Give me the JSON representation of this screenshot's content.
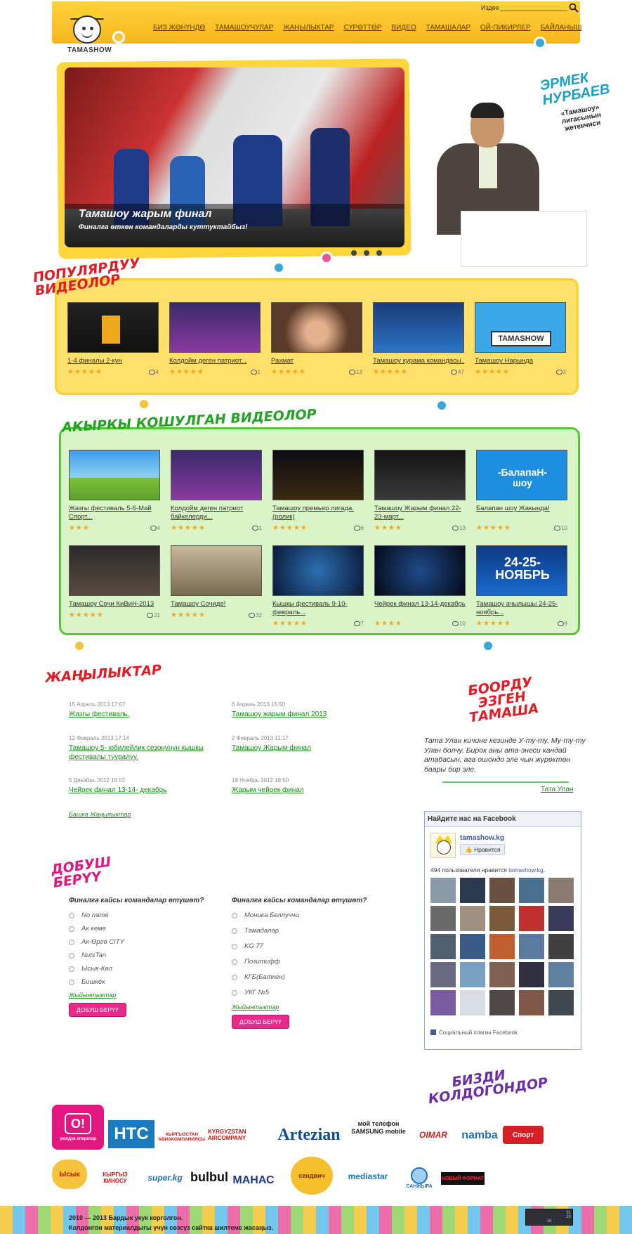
{
  "header": {
    "logo_text": "TAMASHOW",
    "search_label": "Издөө",
    "search_value": "",
    "nav": [
      "БИЗ ЖӨНҮНДӨ",
      "ТАМАШОУЧУЛАР",
      "ЖАҢЫЛЫКТАР",
      "СҮРӨТТӨР",
      "ВИДЕО",
      "ТАМАШАЛАР",
      "ОЙ-ПИКИРЛЕР",
      "БАЙЛАНЫШ"
    ]
  },
  "hero": {
    "title": "Тамашоу жарым финал",
    "subtitle": "Финалга өткөн командаларды куттуктайбыз!",
    "slides": 3,
    "host_name": "ЭРМЕК НУРБАЕВ",
    "host_role": "«Тамашоу» лигасынын жетекчиси"
  },
  "popular": {
    "title": "ПОПУЛЯРДУУ ВИДЕОЛОР",
    "videos": [
      {
        "title": "1-4 финалы 2-кун",
        "stars": "★★★★★",
        "comments": "4"
      },
      {
        "title": "Колдойм деген патриот...",
        "stars": "★★★★★",
        "comments": "1"
      },
      {
        "title": "Рахмат",
        "stars": "★★★★★",
        "comments": "13"
      },
      {
        "title": "Тамашоу курама командасы...",
        "stars": "★★★★★",
        "comments": "47"
      },
      {
        "title": "Тамашоу Нарында",
        "stars": "★★★★★",
        "comments": "3"
      }
    ]
  },
  "latest": {
    "title": "АКЫРКЫ КОШУЛГАН ВИДЕОЛОР",
    "videos": [
      {
        "title": "Жазгы фестиваль 5-6-Май Спорт...",
        "stars": "★★★",
        "comments": "4"
      },
      {
        "title": "Колдойм деген патриот байкелерди...",
        "stars": "★★★★★",
        "comments": "1"
      },
      {
        "title": "Тамашоу премьер лигада. (ролик)",
        "stars": "★★★★★",
        "comments": "6"
      },
      {
        "title": "Тамашоу Жарым финал 22-23-март...",
        "stars": "★★★★",
        "comments": "13"
      },
      {
        "title": "Балапан шоу Жакында!",
        "stars": "★★★★★",
        "comments": "10"
      },
      {
        "title": "Тамашоу Сочи КиВиН-2013",
        "stars": "★★★★★",
        "comments": "21"
      },
      {
        "title": "Тамашоу Сочиде!",
        "stars": "★★★★★",
        "comments": "32"
      },
      {
        "title": "Кышкы фестиваль 9-10-февраль...",
        "stars": "★★★★★",
        "comments": "7"
      },
      {
        "title": "Чейрек финал 13-14-декабрь",
        "stars": "★★★★",
        "comments": "10"
      },
      {
        "title": "Тамашоу ачылышы 24-25-ноябрь...",
        "stars": "★★★★★",
        "comments": "9"
      }
    ]
  },
  "news": {
    "title": "ЖАҢЫЛЫКТАР",
    "items": [
      {
        "date": "15 Апрель 2013 17:07",
        "title": "Жазгы фестиваль."
      },
      {
        "date": "6 Апрель 2013 15:50",
        "title": "Тамашоу жарым финал 2013"
      },
      {
        "date": "12 Февраль 2013 17:14",
        "title": "Тамашоу 5- юбилейлик сезонунун кышкы фестивалы тууралуу."
      },
      {
        "date": "2 Февраль 2013 11:17",
        "title": "Тамашоу Жарым финал"
      },
      {
        "date": "5 Декабрь 2012 16:02",
        "title": "Чейрек финал 13-14- декабрь"
      },
      {
        "date": "19 Ноябрь 2012 18:50",
        "title": "Жарым чейрек финал"
      }
    ],
    "more": "Башка Жаңылыктар"
  },
  "joke": {
    "title": "БООРДУ ЭЗГЕН ТАМАША",
    "text": "Тата Улан кичине кезинде У-ту-ту, Му-ту-ту Улан болчу. Бирок аны ата-энеси кандай атабасын, ага ошондо эле чын жүрөктөн баары бир эле.",
    "author": "Тата Улан"
  },
  "facebook": {
    "header": "Найдите нас на Facebook",
    "page_name": "tamashow.kg",
    "like_button": "Нравится",
    "count_prefix": "494 пользователя нравится ",
    "count_link": "tamashow.kg",
    "count_suffix": ".",
    "footer": "Социальный плагин Facebook"
  },
  "poll": {
    "title": "ДОБУШ БЕРҮҮ",
    "left": {
      "question": "Финалга кайсы командалар өтүшөт?",
      "options": [
        "No name",
        "Ак кеме",
        "Ак-Өргө CITY",
        "NutsTan",
        "Ысык-Көл",
        "Бишкек"
      ],
      "results": "Жыйынтыктар",
      "vote": "ДОБУШ БЕРҮҮ"
    },
    "right": {
      "question": "Финалга кайсы командалар өтүшөт?",
      "options": [
        "Моника Беллуччи",
        "Тамадалар",
        "KG 77",
        "Позитифф",
        "КГБ(Баткен)",
        "УКГ №5"
      ],
      "results": "Жыйынтыктар",
      "vote": "ДОБУШ БЕРҮҮ"
    }
  },
  "sponsors": {
    "title": "БИЗДИ КОЛДОГОНДОР",
    "row1": [
      "O!",
      "HTC",
      "КЫРГЫЗСТАН АВИАКОМПАНИЯСЫ",
      "Artezian",
      "мой телефон SAMSUNG mobile",
      "OIMAR",
      "namba",
      "Спорт"
    ],
    "row2": [
      "Ысык",
      "КЫРГЫЗ КИНОСУ",
      "super.kg",
      "bulbul",
      "МАНАС",
      "сендвич",
      "mediastar",
      "САНЖЫРА",
      "НОВЫЙ ФОРМАТ"
    ],
    "o_caption": "уюлдук оператор"
  },
  "footer": {
    "line1": "2010 — 2013 Бардык укук корголгон.",
    "line2": "Колдонгон материалдыгы үчүн сөзсүз сайтка шилтеме жасаңыз."
  },
  "counter": {
    "a": "91",
    "b": "33",
    "c": "16"
  }
}
